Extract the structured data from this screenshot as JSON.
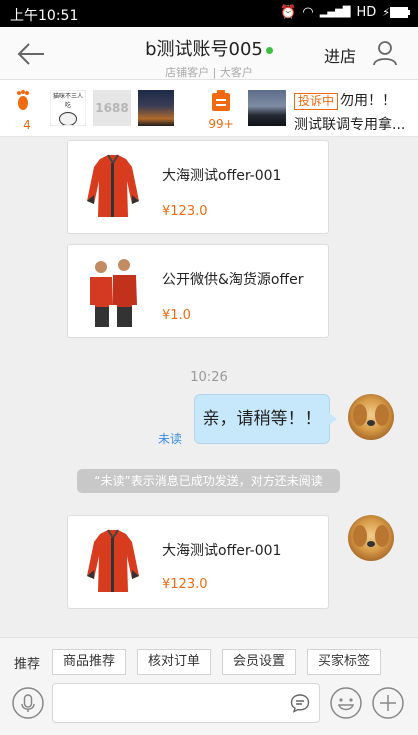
{
  "status_bar": {
    "time": "上午10:51",
    "alarm_glyph": "⏰",
    "wifi_glyph": "◠",
    "signal_glyph": "▂▄▆█",
    "network": "HD",
    "charge_glyph": "⚡"
  },
  "header": {
    "title": "b测试账号005",
    "subtitle": "店铺客户 | 大客户",
    "shop_link": "进店"
  },
  "strip": {
    "footprint_count": "4",
    "meme_caption": "猫咪不三人吃",
    "logo_text": "1688",
    "clipboard_count": "99+",
    "complaint_badge": "投诉中",
    "complaint_title": "勿用！！",
    "complaint_desc": "测试联调专用拿..."
  },
  "messages": {
    "card1": {
      "name": "大海测试offer-001",
      "price": "¥123.0"
    },
    "card2": {
      "name": "公开微供&淘货源offer",
      "price": "¥1.0"
    },
    "timestamp": "10:26",
    "bubble_text": "亲，请稍等！！",
    "unread_label": "未读",
    "notice": "“未读”表示消息已成功发送，对方还未阅读",
    "card3": {
      "name": "大海测试offer-001",
      "price": "¥123.0"
    }
  },
  "toolbar": {
    "tags_label": "推荐",
    "tags": [
      "商品推荐",
      "核对订单",
      "会员设置",
      "买家标签"
    ],
    "input_placeholder": ""
  },
  "colors": {
    "accent": "#f26a10",
    "bubble": "#c7e7fb",
    "link": "#3a8de0",
    "online": "#3fbf3f"
  },
  "icons": [
    "back-arrow-icon",
    "user-icon",
    "footprint-icon",
    "clipboard-icon",
    "mic-icon",
    "quick-reply-icon",
    "emoji-icon",
    "plus-icon"
  ]
}
